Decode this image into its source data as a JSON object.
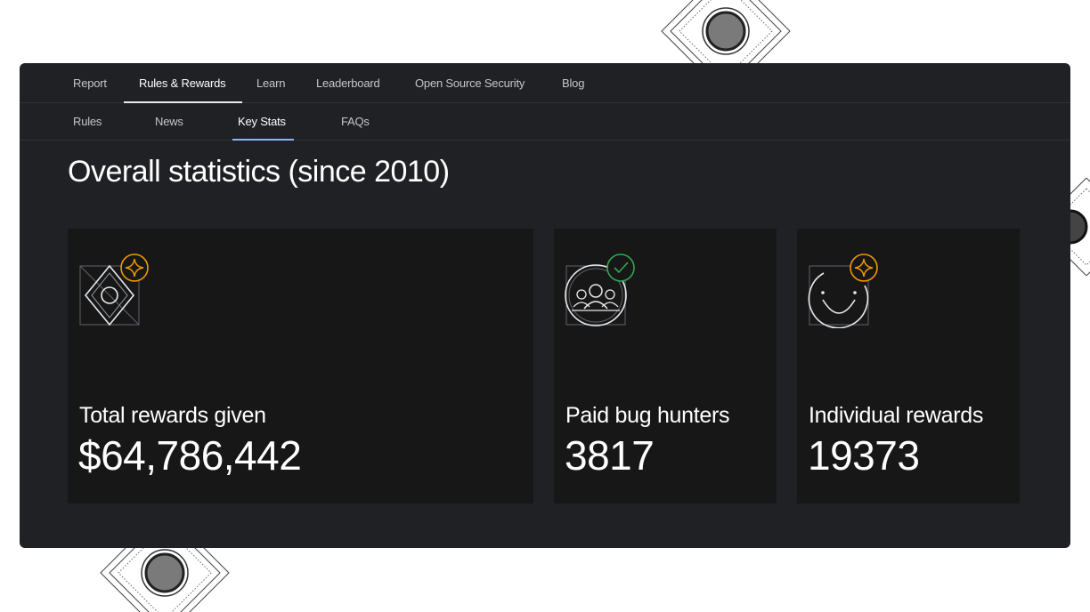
{
  "nav": {
    "primary": [
      {
        "label": "Report"
      },
      {
        "label": "Rules & Rewards",
        "active": true
      },
      {
        "label": "Learn"
      },
      {
        "label": "Leaderboard"
      },
      {
        "label": "Open Source Security"
      },
      {
        "label": "Blog"
      }
    ],
    "secondary": [
      {
        "label": "Rules"
      },
      {
        "label": "News"
      },
      {
        "label": "Key Stats",
        "active": true
      },
      {
        "label": "FAQs"
      }
    ]
  },
  "page": {
    "title": "Overall statistics (since 2010)"
  },
  "stats": [
    {
      "label": "Total rewards given",
      "value": "$64,786,442",
      "icon": "diamond-target-icon",
      "badge": "sparkle-badge-icon"
    },
    {
      "label": "Paid bug hunters",
      "value": "3817",
      "icon": "people-group-icon",
      "badge": "check-badge-icon"
    },
    {
      "label": "Individual rewards",
      "value": "19373",
      "icon": "smile-icon",
      "badge": "sparkle-badge-icon"
    }
  ],
  "colors": {
    "panel_bg": "#202124",
    "card_bg": "#171717",
    "accent_blue": "#8ab4f8",
    "badge_orange": "#f29900",
    "badge_green": "#34a853"
  }
}
